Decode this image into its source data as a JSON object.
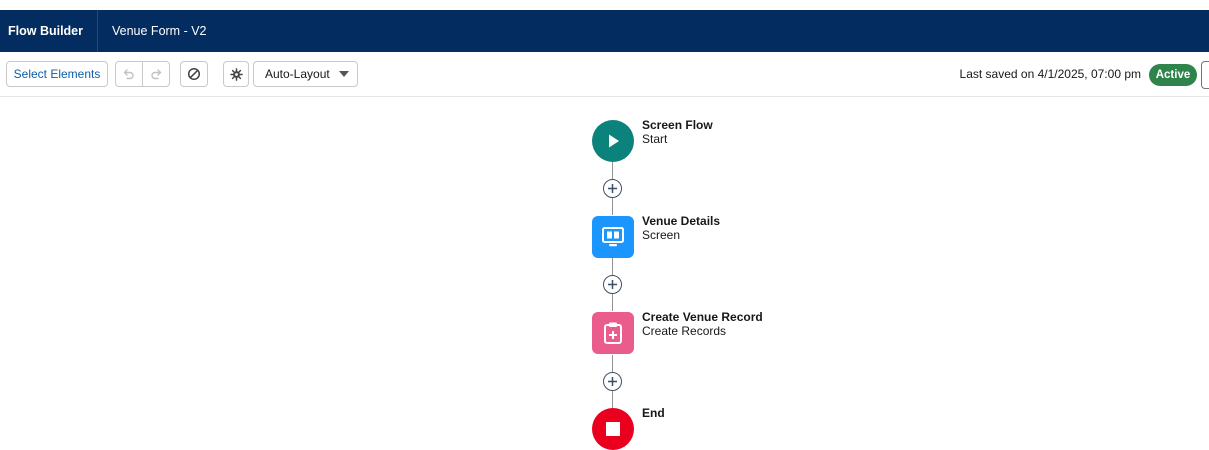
{
  "header": {
    "app_name": "Flow Builder",
    "flow_name": "Venue Form - V2"
  },
  "toolbar": {
    "select_elements_label": "Select Elements",
    "layout_mode_label": "Auto-Layout",
    "last_saved": "Last saved on 4/1/2025, 07:00 pm",
    "status_badge": "Active"
  },
  "flow": {
    "nodes": [
      {
        "title": "Screen Flow",
        "subtitle": "Start",
        "icon": "play-icon",
        "color": "#0b827c"
      },
      {
        "title": "Venue Details",
        "subtitle": "Screen",
        "icon": "monitor-icon",
        "color": "#1b96ff"
      },
      {
        "title": "Create Venue Record",
        "subtitle": "Create Records",
        "icon": "clipboard-plus-icon",
        "color": "#ea5c8c"
      },
      {
        "title": "End",
        "subtitle": "",
        "icon": "stop-icon",
        "color": "#ea001e"
      }
    ]
  },
  "colors": {
    "header_bg": "#032d60",
    "badge_bg": "#2e844a",
    "link": "#0b5cab"
  }
}
